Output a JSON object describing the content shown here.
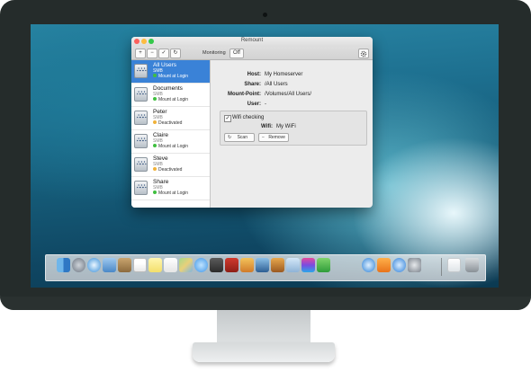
{
  "window": {
    "title": "Remount"
  },
  "toolbar": {
    "add_label": "+",
    "remove_label": "−",
    "check_label": "✓",
    "refresh_label": "↻",
    "monitoring_label": "Monitoring",
    "monitoring_value": "Off",
    "settings_icon": "gear-icon"
  },
  "sidebar": {
    "items": [
      {
        "name": "All Users",
        "type": "SMB",
        "status": "Mount at Login",
        "status_color": "#3fbf3f"
      },
      {
        "name": "Documents",
        "type": "SMB",
        "status": "Mount at Login",
        "status_color": "#3fbf3f"
      },
      {
        "name": "Peter",
        "type": "SMB",
        "status": "Deactivated",
        "status_color": "#f0b23a"
      },
      {
        "name": "Claire",
        "type": "SMB",
        "status": "Mount at Login",
        "status_color": "#3fbf3f"
      },
      {
        "name": "Steve",
        "type": "SMB",
        "status": "Deactivated",
        "status_color": "#f0b23a"
      },
      {
        "name": "Share",
        "type": "SMB",
        "status": "Mount at Login",
        "status_color": "#3fbf3f"
      }
    ],
    "selected_index": 0,
    "disk_glyph": "⛬⛬⛬"
  },
  "details": {
    "host_label": "Host:",
    "host_value": "My Homeserver",
    "share_label": "Share:",
    "share_value": "/All Users",
    "mount_point_label": "Mount-Point:",
    "mount_point_value": "/Volumes/All Users/",
    "user_label": "User:",
    "user_value": "-",
    "wifi_checking_label": "Wifi checking",
    "wifi_checking_checked": true,
    "wifi_label": "Wifi:",
    "wifi_value": "My WiFi",
    "scan_label": "Scan",
    "remove_label": "Remove",
    "check_glyph": "✓",
    "scan_glyph": "↻",
    "remove_glyph": "−"
  },
  "dock": {
    "icons": [
      "finder-icon",
      "launchpad-icon",
      "safari-icon",
      "mail-icon",
      "contacts-icon",
      "calendar-icon",
      "notes-icon",
      "reminders-icon",
      "maps-icon",
      "messages-icon",
      "facetime-icon",
      "photo-booth-icon",
      "iphoto-icon",
      "imovie-icon",
      "garageband-icon",
      "preview-icon",
      "keynote-icon",
      "numbers-icon",
      "itunes-icon",
      "ibooks-icon",
      "app-store-icon",
      "system-preferences-icon",
      "documents-icon",
      "trash-icon"
    ]
  },
  "colors": {
    "accent": "#3a82d7",
    "bezel": "#252c2b",
    "wallpaper": "#1d6f8f"
  }
}
